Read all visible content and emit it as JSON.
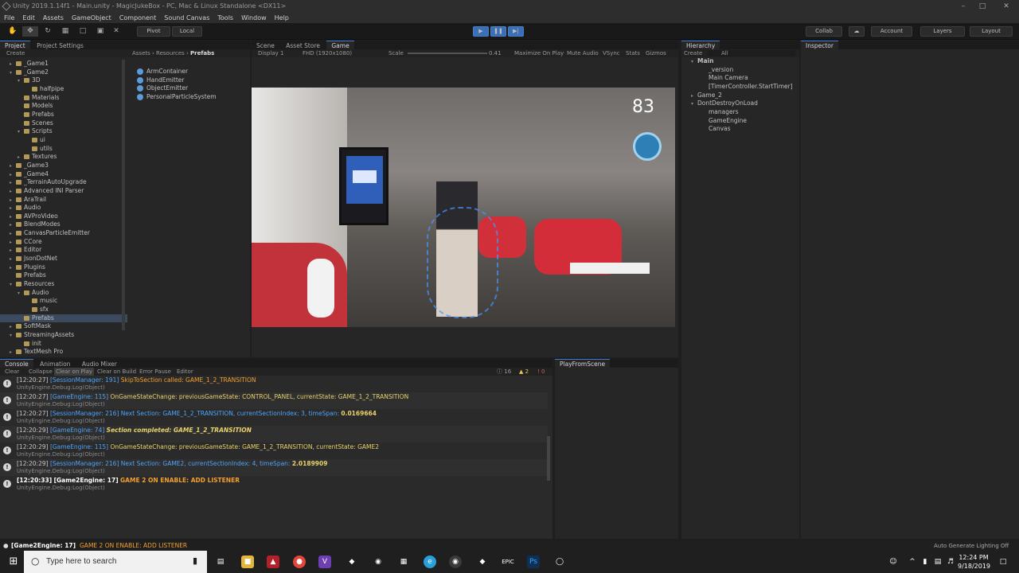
{
  "window": {
    "title": "Unity 2019.1.14f1 - Main.unity - MagicJukeBox - PC, Mac & Linux Standalone <DX11>"
  },
  "menu": [
    "File",
    "Edit",
    "Assets",
    "GameObject",
    "Component",
    "Sound Canvas",
    "Tools",
    "Window",
    "Help"
  ],
  "toolbar": {
    "pivot": "Pivot",
    "local": "Local",
    "collab": "Collab",
    "account": "Account",
    "layers": "Layers",
    "layout": "Layout"
  },
  "project": {
    "tab1": "Project",
    "tab2": "Project Settings",
    "create": "Create",
    "breadcrumb_root": "Assets",
    "breadcrumb_mid": "Resources",
    "breadcrumb_leaf": "Prefabs",
    "tree": [
      "_Game1",
      "_Game2",
      "3D",
      "halfpipe",
      "Materials",
      "Models",
      "Prefabs",
      "Scenes",
      "Scripts",
      "ui",
      "utils",
      "Textures",
      "_Game3",
      "_Game4",
      "_TerrainAutoUpgrade",
      "Advanced INI Parser",
      "AraTrail",
      "Audio",
      "AVProVideo",
      "BlendModes",
      "CanvasParticleEmitter",
      "CCore",
      "Editor",
      "JsonDotNet",
      "Plugins",
      "Prefabs",
      "Resources",
      "Audio",
      "music",
      "sfx",
      "Prefabs",
      "SoftMask",
      "StreamingAssets",
      "init",
      "TextMesh Pro"
    ],
    "assets": [
      "ArmContainer",
      "HandEmitter",
      "ObjectEmitter",
      "PersonalParticleSystem"
    ]
  },
  "scene": {
    "tab_scene": "Scene",
    "tab_store": "Asset Store",
    "tab_game": "Game",
    "display": "Display 1",
    "resolution": "FHD (1920x1080)",
    "scale_label": "Scale",
    "scale_value": "0.41",
    "maximize": "Maximize On Play",
    "mute": "Mute Audio",
    "vsync": "VSync",
    "stats": "Stats",
    "gizmos": "Gizmos",
    "score": "83"
  },
  "hierarchy": {
    "tab": "Hierarchy",
    "create": "Create",
    "search": "All",
    "items": [
      "Main",
      "_version",
      "Main Camera",
      "[TimerController.StartTimer]",
      "Game_2",
      "DontDestroyOnLoad",
      "managers",
      "GameEngine",
      "Canvas"
    ]
  },
  "inspector": {
    "tab": "Inspector"
  },
  "console": {
    "tab1": "Console",
    "tab2": "Animation",
    "tab3": "Audio Mixer",
    "clear": "Clear",
    "collapse": "Collapse",
    "clear_on_play": "Clear on Play",
    "clear_on_build": "Clear on Build",
    "error_pause": "Error Pause",
    "editor": "Editor",
    "info_count": "16",
    "warn_count": "2",
    "err_count": "0",
    "entries": [
      {
        "time": "[12:20:27]",
        "source": "[SessionManager: 191]",
        "msg": "SkipToSection called: GAME_1_2_TRANSITION",
        "num": "",
        "sub": "UnityEngine.Debug:Log(Object)"
      },
      {
        "time": "[12:20:27]",
        "source": "[GameEngine: 115]",
        "msg": "OnGameStateChange: previousGameState: CONTROL_PANEL, currentState: GAME_1_2_TRANSITION",
        "num": "",
        "sub": "UnityEngine.Debug:Log(Object)"
      },
      {
        "time": "[12:20:27]",
        "source": "[SessionManager: 216]",
        "msg": "Next Section: GAME_1_2_TRANSITION, currentSectionIndex: 3, timeSpan:",
        "num": "0.0169664",
        "sub": "UnityEngine.Debug:Log(Object)"
      },
      {
        "time": "[12:20:29]",
        "source": "[GameEngine: 74]",
        "msg": "Section completed: GAME_1_2_TRANSITION",
        "num": "",
        "sub": "UnityEngine.Debug:Log(Object)"
      },
      {
        "time": "[12:20:29]",
        "source": "[GameEngine: 115]",
        "msg": "OnGameStateChange: previousGameState: GAME_1_2_TRANSITION, currentState: GAME2",
        "num": "",
        "sub": "UnityEngine.Debug:Log(Object)"
      },
      {
        "time": "[12:20:29]",
        "source": "[SessionManager: 216]",
        "msg": "Next Section: GAME2, currentSectionIndex: 4, timeSpan:",
        "num": "2.0189909",
        "sub": "UnityEngine.Debug:Log(Object)"
      },
      {
        "time": "[12:20:33]",
        "source": "[Game2Engine: 17]",
        "msg": "GAME 2 ON ENABLE: ADD LISTENER",
        "num": "",
        "sub": "UnityEngine.Debug:Log(Object)"
      }
    ]
  },
  "playfromscene": {
    "tab": "PlayFromScene"
  },
  "statusbar": {
    "source": "[Game2Engine: 17]",
    "msg": "GAME 2 ON ENABLE: ADD LISTENER",
    "right": "Auto Generate Lighting Off"
  },
  "taskbar": {
    "search": "Type here to search",
    "time": "12:24 PM",
    "date": "9/18/2019"
  },
  "colors": {
    "accent": "#3a7bd5",
    "source_blue": "#4fa3f7",
    "msg_yellow": "#e8d26a",
    "warn_orange": "#f0a030"
  }
}
